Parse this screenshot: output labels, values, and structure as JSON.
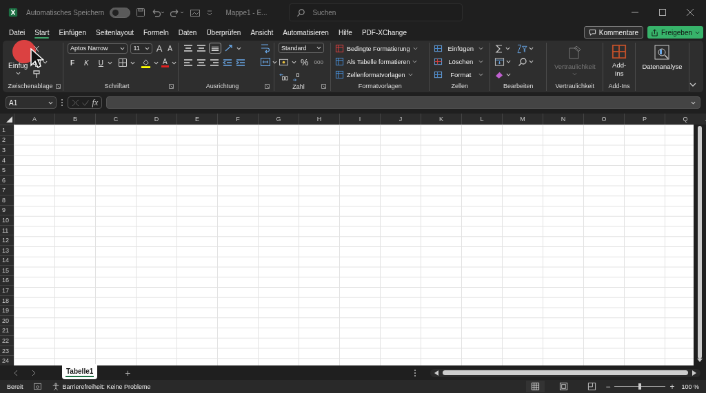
{
  "title_bar": {
    "autosave_label": "Automatisches Speichern",
    "autosave_on": false,
    "document_title": "Mappe1 - E...",
    "search": {
      "placeholder": "Suchen"
    }
  },
  "tabs": [
    {
      "label": "Datei",
      "selected": false
    },
    {
      "label": "Start",
      "selected": true
    },
    {
      "label": "Einfügen",
      "selected": false
    },
    {
      "label": "Seitenlayout",
      "selected": false
    },
    {
      "label": "Formeln",
      "selected": false
    },
    {
      "label": "Daten",
      "selected": false
    },
    {
      "label": "Überprüfen",
      "selected": false
    },
    {
      "label": "Ansicht",
      "selected": false
    },
    {
      "label": "Automatisieren",
      "selected": false
    },
    {
      "label": "Hilfe",
      "selected": false
    },
    {
      "label": "PDF-XChange",
      "selected": false
    }
  ],
  "comments_button": "Kommentare",
  "share_button": "Freigeben",
  "ribbon": {
    "clipboard": {
      "paste_label": "Einfüg",
      "group_label": "Zwischenablage"
    },
    "font": {
      "family": "Aptos Narrow",
      "size": "11",
      "grow": "A",
      "shrink": "A",
      "bold": "F",
      "italic": "K",
      "underline": "U",
      "font_color": "A",
      "group_label": "Schriftart"
    },
    "alignment": {
      "group_label": "Ausrichtung"
    },
    "number": {
      "format": "Standard",
      "percent": "%",
      "thousands": "000",
      "group_label": "Zahl"
    },
    "styles": {
      "items": [
        "Bedingte Formatierung",
        "Als Tabelle formatieren",
        "Zellenformatvorlagen"
      ],
      "group_label": "Formatvorlagen"
    },
    "cells": {
      "items": [
        "Einfügen",
        "Löschen",
        "Format"
      ],
      "group_label": "Zellen"
    },
    "editing": {
      "group_label": "Bearbeiten"
    },
    "sensitivity": {
      "button": "Vertraulichkeit",
      "disabled": true,
      "group_label": "Vertraulichkeit"
    },
    "addins": {
      "button": "Add-Ins",
      "group_label": "Add-Ins"
    },
    "analysis": {
      "button": "Datenanalyse"
    }
  },
  "formula_bar": {
    "name_box": "A1",
    "fx": "fx"
  },
  "columns": [
    "A",
    "B",
    "C",
    "D",
    "E",
    "F",
    "G",
    "H",
    "I",
    "J",
    "K",
    "L",
    "M",
    "N",
    "O",
    "P",
    "Q"
  ],
  "rows": [
    "1",
    "2",
    "3",
    "4",
    "5",
    "6",
    "7",
    "8",
    "9",
    "10",
    "11",
    "12",
    "13",
    "14",
    "15",
    "16",
    "17",
    "18",
    "19",
    "20",
    "21",
    "22",
    "23",
    "24"
  ],
  "sheet_tabs": [
    {
      "label": "Tabelle1",
      "selected": true
    }
  ],
  "add_sheet": "+",
  "status_bar": {
    "ready": "Bereit",
    "accessibility": "Barrierefreiheit: Keine Probleme",
    "zoom": {
      "minus": "−",
      "level": 0.5,
      "plus": "+",
      "reading": "100 %"
    }
  }
}
